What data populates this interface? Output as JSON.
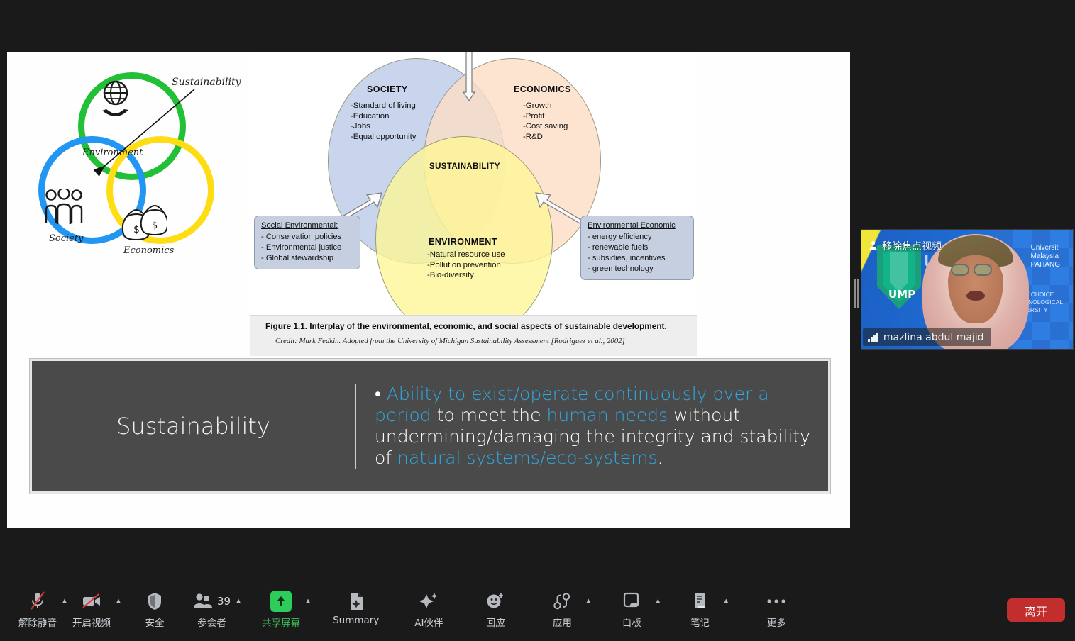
{
  "app": {
    "name": "Zoom Meeting",
    "background_color": "#1a1a1a"
  },
  "shared_slide": {
    "left_illustration": {
      "title_label": "Sustainability",
      "ring_labels": [
        "Environment",
        "Society",
        "Economics"
      ],
      "ring_colors": [
        "#22c036",
        "#2196f3",
        "#ffdd15"
      ],
      "icons": [
        "globe-in-hand-icon",
        "people-group-icon",
        "money-bags-icon"
      ],
      "arrow": "pointer-arrow"
    },
    "venn_figure": {
      "circles": [
        {
          "name": "SOCIETY",
          "color": "#bacbe9",
          "items": [
            "-Standard of living",
            "-Education",
            "-Jobs",
            "-Equal opportunity"
          ]
        },
        {
          "name": "ECONOMICS",
          "color": "#fddcc6",
          "items": [
            "-Growth",
            "-Profit",
            "-Cost saving",
            "-R&D"
          ]
        },
        {
          "name": "ENVIRONMENT",
          "color": "#fdf696",
          "items": [
            "-Natural resource use",
            "-Pollution prevention",
            "-Bio-diversity"
          ]
        }
      ],
      "center_label": "SUSTAINABILITY",
      "callouts": [
        {
          "title": "Social Environmental:",
          "items": [
            "- Conservation policies",
            "- Environmental justice",
            "- Global stewardship"
          ]
        },
        {
          "title": "Environmental  Economic",
          "items": [
            "- energy efficiency",
            "- renewable fuels",
            "- subsidies, incentives",
            "- green technology"
          ]
        }
      ],
      "caption": "Figure 1.1. Interplay of the environmental, economic, and social aspects of sustainable development.",
      "credit": "Credit: Mark Fedkin. Adopted from the University of Michigan Sustainability Assessment [Rodriguez et al., 2002]"
    },
    "definition_box": {
      "title": "Sustainability",
      "bullet": "•",
      "segments": [
        {
          "text": "Ability to exist/operate continuously over a period ",
          "highlight": true
        },
        {
          "text": "to meet the ",
          "highlight": false
        },
        {
          "text": "human needs ",
          "highlight": true
        },
        {
          "text": "without undermining/damaging the integrity and stability of ",
          "highlight": false
        },
        {
          "text": "natural systems/eco-systems",
          "highlight": true
        },
        {
          "text": ".",
          "highlight": false
        }
      ],
      "highlight_color": "#2fa8e0",
      "background_color": "#4a4a4a"
    }
  },
  "video_thumbnail": {
    "pin_overlay_label": "移除焦点视频",
    "pin_icon": "unpin-video-icon",
    "participant_name": "mazlina abdul majid",
    "signal_icon": "signal-bars-icon",
    "background_text": {
      "brand": "UMP",
      "line1": "Universiti",
      "line2": "Malaysia",
      "line3": "PAHANG",
      "tagline1": "FIRST CHOICE",
      "tagline2": "TECHNOLOGICAL",
      "tagline3": "UNIVERSITY"
    }
  },
  "toolbar": {
    "items": [
      {
        "label": "解除静音",
        "icon": "microphone-muted-icon",
        "has_caret": true,
        "green": false
      },
      {
        "label": "开启视频",
        "icon": "video-off-icon",
        "has_caret": true,
        "green": false
      },
      {
        "label": "安全",
        "icon": "shield-icon",
        "has_caret": false,
        "green": false
      },
      {
        "label": "参会者",
        "icon": "participants-icon",
        "has_caret": true,
        "green": false,
        "count": "39"
      },
      {
        "label": "共享屏幕",
        "icon": "share-screen-icon",
        "has_caret": true,
        "green": true
      },
      {
        "label": "Summary",
        "icon": "summary-document-icon",
        "has_caret": false,
        "green": false
      },
      {
        "label": "AI伙伴",
        "icon": "ai-sparkle-icon",
        "has_caret": false,
        "green": false
      },
      {
        "label": "回应",
        "icon": "reactions-smiley-icon",
        "has_caret": false,
        "green": false
      },
      {
        "label": "应用",
        "icon": "apps-icon",
        "has_caret": true,
        "green": false
      },
      {
        "label": "白板",
        "icon": "whiteboard-icon",
        "has_caret": true,
        "green": false
      },
      {
        "label": "笔记",
        "icon": "notes-icon",
        "has_caret": true,
        "green": false
      },
      {
        "label": "更多",
        "icon": "more-dots-icon",
        "has_caret": false,
        "green": false
      }
    ],
    "leave_button": {
      "label": "离开",
      "color": "#c22e2e"
    },
    "share_button_color": "#2ecc5b"
  }
}
